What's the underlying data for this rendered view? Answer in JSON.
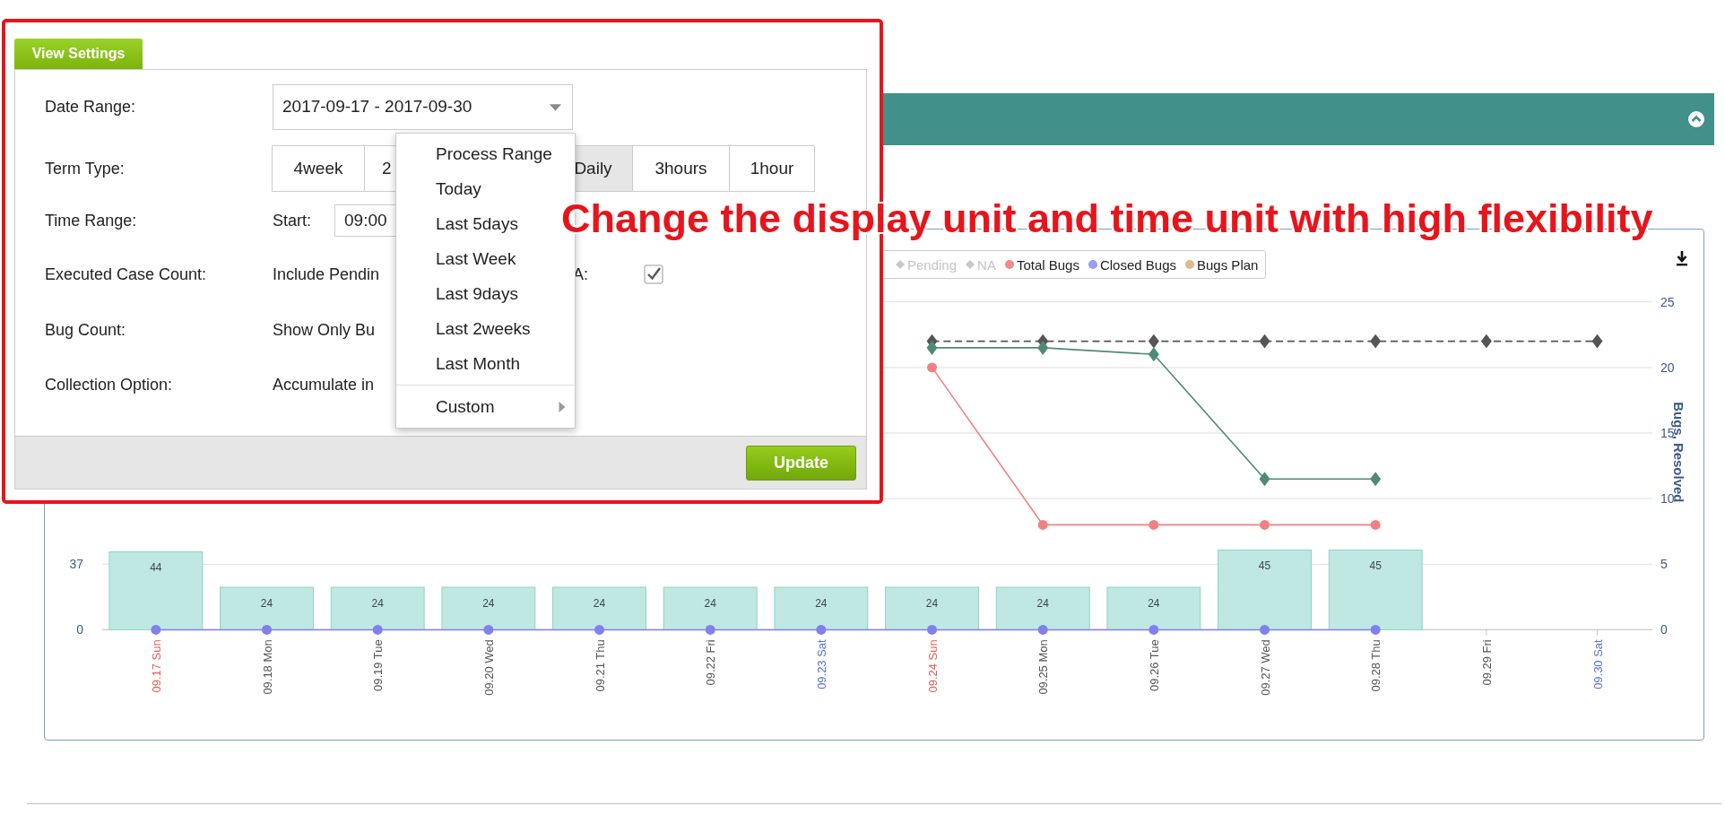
{
  "chart": {
    "legend": [
      {
        "label": "Pending",
        "color": "#c8c8c8",
        "kind": "diamond",
        "visible": false
      },
      {
        "label": "NA",
        "color": "#c8c8c8",
        "kind": "diamond",
        "visible": false
      },
      {
        "label": "Total Bugs",
        "color": "#f28b8b",
        "kind": "circle",
        "visible": true
      },
      {
        "label": "Closed Bugs",
        "color": "#9c9cf5",
        "kind": "circle",
        "visible": true
      },
      {
        "label": "Bugs Plan",
        "color": "#e0b98c",
        "kind": "circle",
        "visible": true
      }
    ],
    "tick_styles": [
      {
        "kind": "sunday"
      },
      {
        "kind": "weekday"
      },
      {
        "kind": "weekday"
      },
      {
        "kind": "weekday"
      },
      {
        "kind": "weekday"
      },
      {
        "kind": "weekday"
      },
      {
        "kind": "saturday"
      },
      {
        "kind": "sunday"
      },
      {
        "kind": "weekday"
      },
      {
        "kind": "weekday"
      },
      {
        "kind": "weekday"
      },
      {
        "kind": "weekday"
      },
      {
        "kind": "weekday"
      },
      {
        "kind": "saturday"
      }
    ],
    "bar_chart": {
      "chart_data": {
        "type": "bar",
        "data_labels": true,
        "categories": [
          "09.17 Sun",
          "09.18 Mon",
          "09.19 Tue",
          "09.20 Wed",
          "09.21 Thu",
          "09.22 Fri",
          "09.23 Sat",
          "09.24 Sun",
          "09.25 Mon",
          "09.26 Tue",
          "09.27 Wed",
          "09.28 Thu",
          "09.29 Fri",
          "09.30 Sat"
        ],
        "ylim": [
          0,
          185
        ],
        "yticks": [
          0,
          37
        ],
        "series": [
          {
            "color": "#bfe8e3",
            "values": [
              44,
              24,
              24,
              24,
              24,
              24,
              24,
              24,
              24,
              24,
              45,
              45,
              null,
              null
            ]
          }
        ]
      }
    },
    "line_chart": {
      "chart_data": {
        "type": "line",
        "ylabel": "Bugs, Resolved",
        "ylim": [
          0,
          25
        ],
        "yticks": [
          0,
          5,
          10,
          15,
          20,
          25
        ],
        "series": [
          {
            "color": "#555555",
            "line_style": "dashed",
            "marker": "diamond",
            "values": [
              null,
              null,
              null,
              null,
              null,
              null,
              null,
              22,
              22,
              22,
              22,
              22,
              22,
              22
            ]
          },
          {
            "color": "#4e8a78",
            "line_style": "solid",
            "marker": "diamond",
            "values": [
              null,
              null,
              null,
              null,
              null,
              null,
              null,
              21.5,
              21.5,
              21,
              11.5,
              11.5,
              null,
              null
            ]
          },
          {
            "color": "#f28080",
            "line_style": "solid",
            "marker": "circle",
            "values": [
              null,
              null,
              null,
              null,
              null,
              null,
              null,
              20,
              8,
              8,
              8,
              8,
              null,
              null
            ]
          },
          {
            "color": "#8080f0",
            "line_style": "solid",
            "marker": "circle",
            "values": [
              0,
              0,
              0,
              0,
              0,
              0,
              0,
              0,
              0,
              0,
              0,
              0,
              null,
              null
            ]
          }
        ]
      }
    }
  },
  "settings": {
    "tab": "View Settings",
    "rows": [
      {
        "kind": "select",
        "label": "Date Range:",
        "value": "2017-09-17 - 2017-09-30"
      },
      {
        "kind": "segmented",
        "label": "Term Type:",
        "options": [
          {
            "label": "4week",
            "selected": false
          },
          {
            "label": "2",
            "selected": false
          },
          {
            "label": "Daily",
            "selected": true
          },
          {
            "label": "3hours",
            "selected": false
          },
          {
            "label": "1hour",
            "selected": false
          }
        ]
      },
      {
        "kind": "time",
        "label": "Time Range:",
        "prefix": "Start:",
        "value": "09:00"
      },
      {
        "kind": "check",
        "label": "Executed Case Count:",
        "text": "Include Pendin",
        "check_label": "A:",
        "checked": true
      },
      {
        "kind": "text",
        "label": "Bug Count:",
        "text": "Show Only Bu"
      },
      {
        "kind": "text",
        "label": "Collection Option:",
        "text": "Accumulate in"
      }
    ],
    "dropdown": {
      "items": [
        {
          "label": "Process Range",
          "submenu": false,
          "divider": false
        },
        {
          "label": "Today",
          "submenu": false,
          "divider": false
        },
        {
          "label": "Last 5days",
          "submenu": false,
          "divider": false
        },
        {
          "label": "Last Week",
          "submenu": false,
          "divider": false
        },
        {
          "label": "Last 9days",
          "submenu": false,
          "divider": false
        },
        {
          "label": "Last 2weeks",
          "submenu": false,
          "divider": false
        },
        {
          "label": "Last Month",
          "submenu": false,
          "divider": false
        },
        {
          "label": "Custom",
          "submenu": true,
          "divider": true
        }
      ]
    },
    "update_button": "Update"
  },
  "annotation": {
    "text": "Change the display unit and time unit with high flexibility"
  }
}
